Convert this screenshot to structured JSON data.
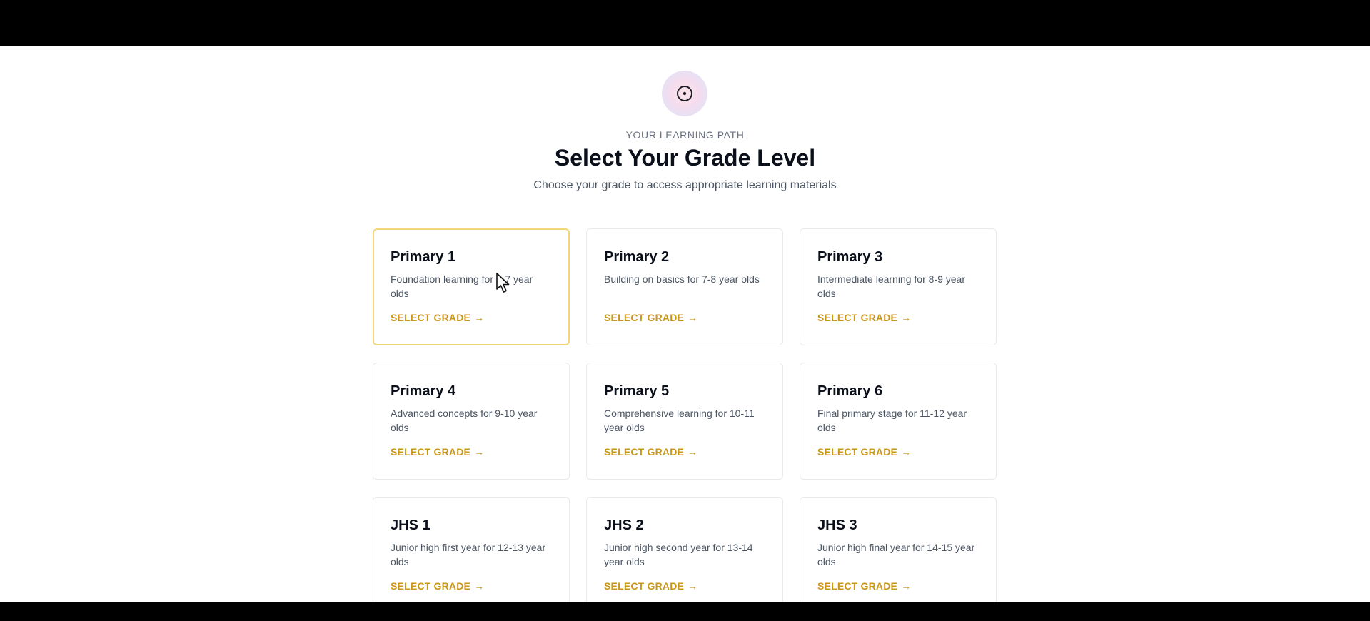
{
  "header": {
    "icon": "target-icon",
    "eyebrow": "YOUR LEARNING PATH",
    "title": "Select Your Grade Level",
    "subtitle": "Choose your grade to access appropriate learning materials"
  },
  "grades": [
    {
      "title": "Primary 1",
      "description": "Foundation learning for 6-7 year olds",
      "action": "SELECT GRADE",
      "highlighted": true
    },
    {
      "title": "Primary 2",
      "description": "Building on basics for 7-8 year olds",
      "action": "SELECT GRADE"
    },
    {
      "title": "Primary 3",
      "description": "Intermediate learning for 8-9 year olds",
      "action": "SELECT GRADE"
    },
    {
      "title": "Primary 4",
      "description": "Advanced concepts for 9-10 year olds",
      "action": "SELECT GRADE"
    },
    {
      "title": "Primary 5",
      "description": "Comprehensive learning for 10-11 year olds",
      "action": "SELECT GRADE"
    },
    {
      "title": "Primary 6",
      "description": "Final primary stage for 11-12 year olds",
      "action": "SELECT GRADE"
    },
    {
      "title": "JHS 1",
      "description": "Junior high first year for 12-13 year olds",
      "action": "SELECT GRADE"
    },
    {
      "title": "JHS 2",
      "description": "Junior high second year for 13-14 year olds",
      "action": "SELECT GRADE"
    },
    {
      "title": "JHS 3",
      "description": "Junior high final year for 14-15 year olds",
      "action": "SELECT GRADE"
    }
  ],
  "colors": {
    "accent": "#c9971a",
    "highlight_border": "#f2d77a"
  }
}
